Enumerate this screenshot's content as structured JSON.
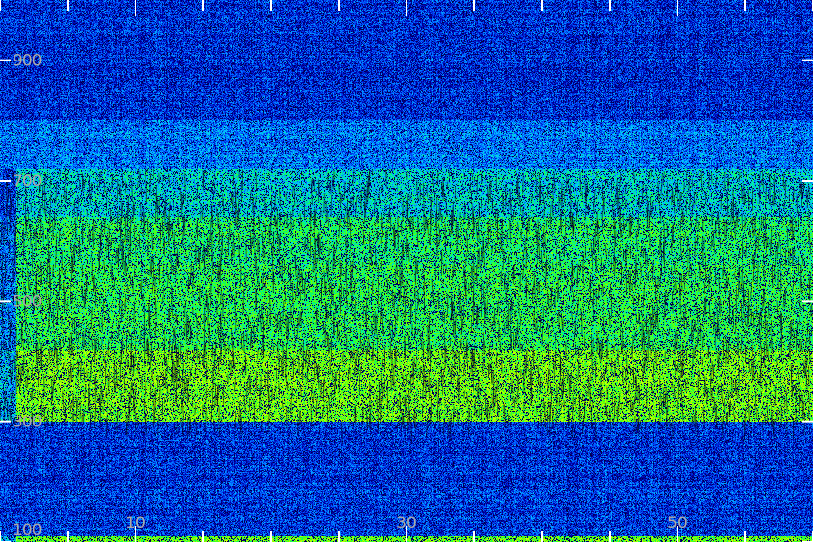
{
  "chart_data": {
    "type": "heatmap",
    "title": "",
    "xlabel": "",
    "ylabel": "",
    "xlim": [
      0,
      60
    ],
    "ylim": [
      100,
      1000
    ],
    "x_tick_labels": [
      "10",
      "30",
      "50"
    ],
    "y_tick_labels": [
      "100",
      "300",
      "500",
      "700",
      "900"
    ],
    "x_tick_values": [
      0,
      5,
      10,
      15,
      20,
      25,
      30,
      35,
      40,
      45,
      50,
      55,
      60
    ],
    "x_label_values": [
      10,
      30,
      50
    ],
    "y_tick_values": [
      100,
      300,
      500,
      700,
      900
    ],
    "grid": false,
    "colormap": [
      "#000033",
      "#0000aa",
      "#0055ff",
      "#00ccff",
      "#00ff66",
      "#66ff00",
      "#ccff00"
    ],
    "intensity_bands": [
      {
        "y_from": 100,
        "y_to": 110,
        "level": 0.82
      },
      {
        "y_from": 110,
        "y_to": 300,
        "level": 0.28
      },
      {
        "y_from": 300,
        "y_to": 420,
        "level": 0.85
      },
      {
        "y_from": 420,
        "y_to": 560,
        "level": 0.72
      },
      {
        "y_from": 560,
        "y_to": 640,
        "level": 0.68
      },
      {
        "y_from": 640,
        "y_to": 720,
        "level": 0.55
      },
      {
        "y_from": 720,
        "y_to": 800,
        "level": 0.38
      },
      {
        "y_from": 800,
        "y_to": 1000,
        "level": 0.26
      }
    ]
  }
}
